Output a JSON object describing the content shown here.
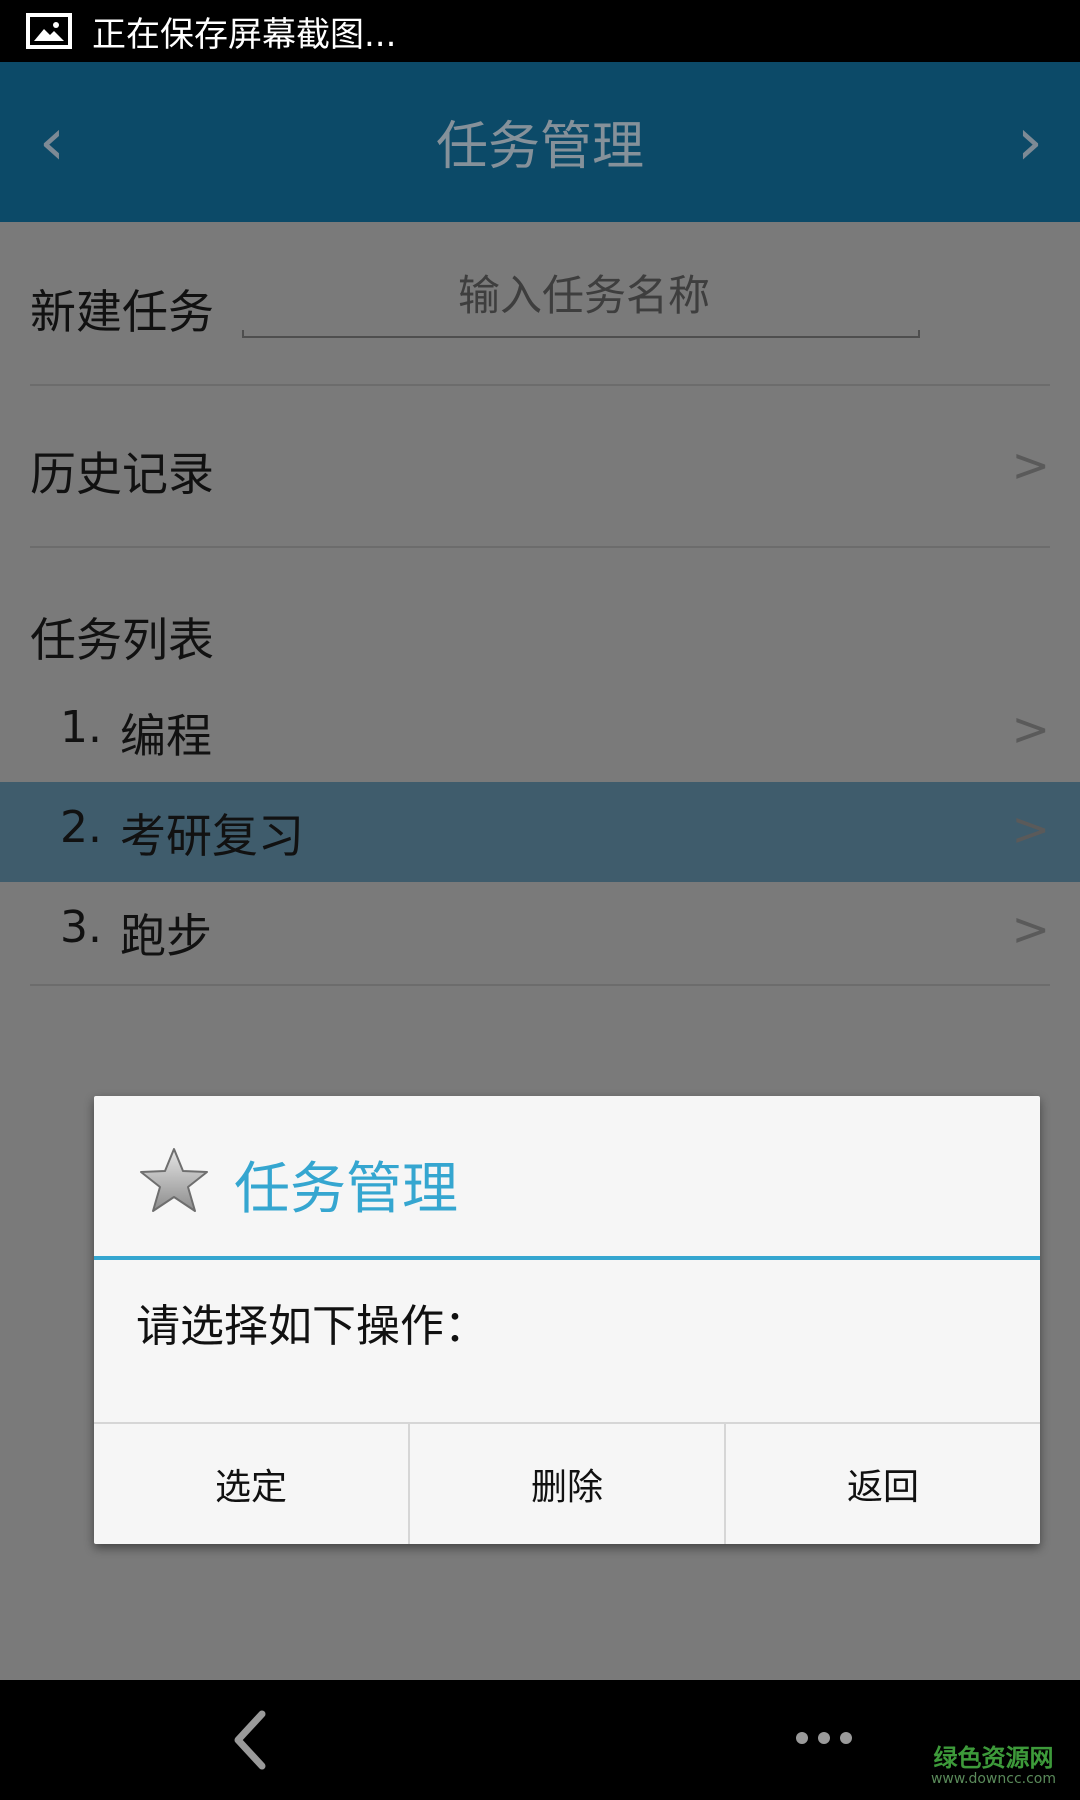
{
  "status_bar": {
    "icon": "image-icon",
    "text": "正在保存屏幕截图..."
  },
  "action_bar": {
    "title": "任务管理",
    "left_arrow": "‹",
    "right_arrow": "›"
  },
  "new_task": {
    "label": "新建任务",
    "placeholder": "输入任务名称",
    "value": ""
  },
  "history": {
    "label": "历史记录",
    "chevron": ">"
  },
  "task_list": {
    "label": "任务列表",
    "items": [
      {
        "num": "1.",
        "text": "编程",
        "chevron": ">",
        "highlighted": false
      },
      {
        "num": "2.",
        "text": "考研复习",
        "chevron": ">",
        "highlighted": true
      },
      {
        "num": "3.",
        "text": "跑步",
        "chevron": ">",
        "highlighted": false
      }
    ]
  },
  "dialog": {
    "icon": "star-icon",
    "title": "任务管理",
    "message": "请选择如下操作：",
    "buttons": [
      "选定",
      "删除",
      "返回"
    ]
  },
  "nav_bar": {
    "back_icon": "back-icon",
    "more_icon": "more-icon"
  },
  "watermark": {
    "main": "绿色资源网",
    "sub": "www.downcc.com"
  },
  "colors": {
    "action_bar": "#0c4a68",
    "accent": "#35a6d0",
    "highlight_row": "#3f5c6c",
    "dim_background": "#7a7a7a"
  }
}
